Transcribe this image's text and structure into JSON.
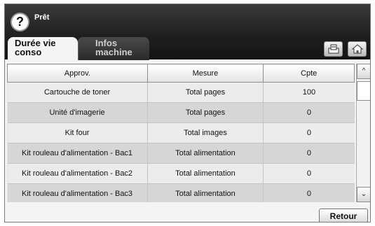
{
  "status": {
    "text": "Prêt",
    "help_label": "?"
  },
  "tabs": [
    {
      "line1": "Durée vie",
      "line2": "conso"
    },
    {
      "line1": "Infos",
      "line2": "machine"
    }
  ],
  "icons": [
    "tray-icon",
    "home-icon"
  ],
  "table": {
    "headers": [
      "Approv.",
      "Mesure",
      "Cpte"
    ],
    "rows": [
      [
        "Cartouche de toner",
        "Total pages",
        "100"
      ],
      [
        "Unité d'imagerie",
        "Total pages",
        "0"
      ],
      [
        "Kit four",
        "Total images",
        "0"
      ],
      [
        "Kit rouleau d'alimentation - Bac1",
        "Total alimentation",
        "0"
      ],
      [
        "Kit rouleau d'alimentation - Bac2",
        "Total alimentation",
        "0"
      ],
      [
        "Kit rouleau d'alimentation - Bac3",
        "Total alimentation",
        "0"
      ]
    ]
  },
  "scroll": {
    "up": "^",
    "down": "⌄"
  },
  "footer": {
    "back_label": "Retour"
  }
}
